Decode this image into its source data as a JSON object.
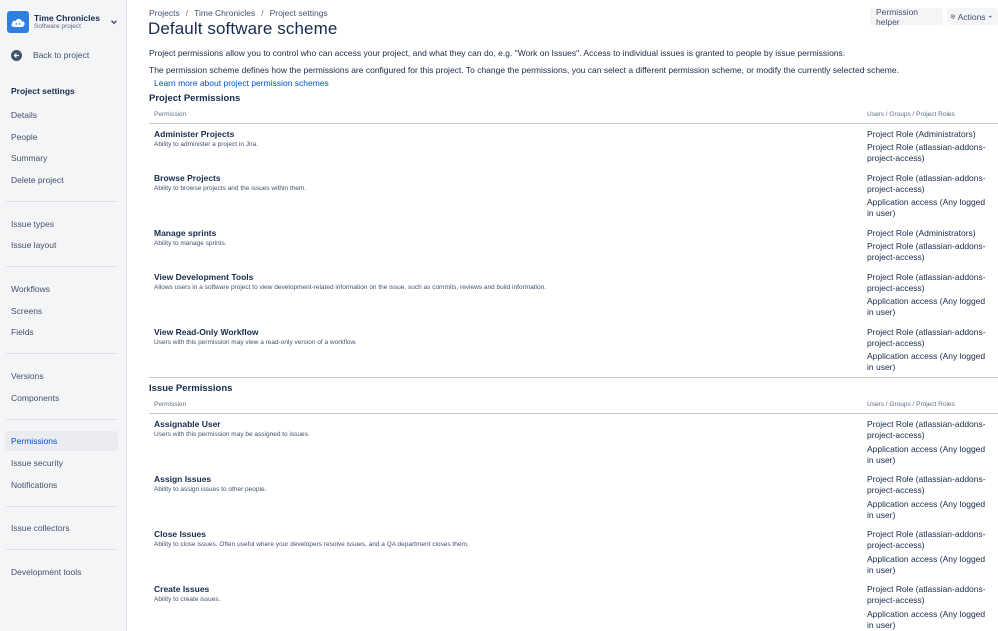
{
  "project": {
    "name": "Time Chronicles",
    "type": "Software project",
    "avatar_color": "#2f7fe0"
  },
  "sidebar": {
    "back_label": "Back to project",
    "heading": "Project settings",
    "items": [
      {
        "label": "Details"
      },
      {
        "label": "People"
      },
      {
        "label": "Summary"
      },
      {
        "label": "Delete project"
      },
      {
        "label": "Issue types"
      },
      {
        "label": "Issue layout"
      },
      {
        "label": "Workflows"
      },
      {
        "label": "Screens"
      },
      {
        "label": "Fields"
      },
      {
        "label": "Versions"
      },
      {
        "label": "Components"
      },
      {
        "label": "Permissions",
        "active": true
      },
      {
        "label": "Issue security"
      },
      {
        "label": "Notifications"
      },
      {
        "label": "Issue collectors"
      },
      {
        "label": "Development tools"
      }
    ]
  },
  "breadcrumbs": [
    "Projects",
    "Time Chronicles",
    "Project settings"
  ],
  "page_title": "Default software scheme",
  "buttons": {
    "helper": "Permission helper",
    "actions": "Actions"
  },
  "intro": {
    "line1": "Project permissions allow you to control who can access your project, and what they can do, e.g. \"Work on Issues\". Access to individual issues is granted to people by issue permissions.",
    "line2": "The permission scheme defines how the permissions are configured for this project. To change the permissions, you can select a different permission scheme, or modify the currently selected scheme.",
    "learn_more": "Learn more about project permission schemes"
  },
  "sections": [
    {
      "title": "Project Permissions",
      "col_permission": "Permission",
      "col_grants": "Users / Groups / Project Roles",
      "rows": [
        {
          "name": "Administer Projects",
          "desc": "Ability to administer a project in Jira.",
          "grants": [
            "Project Role (Administrators)",
            "Project Role (atlassian-addons-project-access)"
          ]
        },
        {
          "name": "Browse Projects",
          "desc": "Ability to browse projects and the issues within them.",
          "grants": [
            "Project Role (atlassian-addons-project-access)",
            "Application access (Any logged in user)"
          ]
        },
        {
          "name": "Manage sprints",
          "desc": "Ability to manage sprints.",
          "grants": [
            "Project Role (Administrators)",
            "Project Role (atlassian-addons-project-access)"
          ]
        },
        {
          "name": "View Development Tools",
          "desc": "Allows users in a software project to view development-related information on the issue, such as commits, reviews and build information.",
          "grants": [
            "Project Role (atlassian-addons-project-access)",
            "Application access (Any logged in user)"
          ]
        },
        {
          "name": "View Read-Only Workflow",
          "desc": "Users with this permission may view a read-only version of a workflow.",
          "grants": [
            "Project Role (atlassian-addons-project-access)",
            "Application access (Any logged in user)"
          ]
        }
      ]
    },
    {
      "title": "Issue Permissions",
      "col_permission": "Permission",
      "col_grants": "Users / Groups / Project Roles",
      "rows": [
        {
          "name": "Assignable User",
          "desc": "Users with this permission may be assigned to issues.",
          "grants": [
            "Project Role (atlassian-addons-project-access)",
            "Application access (Any logged in user)"
          ]
        },
        {
          "name": "Assign Issues",
          "desc": "Ability to assign issues to other people.",
          "grants": [
            "Project Role (atlassian-addons-project-access)",
            "Application access (Any logged in user)"
          ]
        },
        {
          "name": "Close Issues",
          "desc": "Ability to close issues. Often useful where your developers resolve issues, and a QA department closes them.",
          "grants": [
            "Project Role (atlassian-addons-project-access)",
            "Application access (Any logged in user)"
          ]
        },
        {
          "name": "Create Issues",
          "desc": "Ability to create issues.",
          "grants": [
            "Project Role (atlassian-addons-project-access)",
            "Application access (Any logged in user)"
          ]
        }
      ]
    }
  ]
}
